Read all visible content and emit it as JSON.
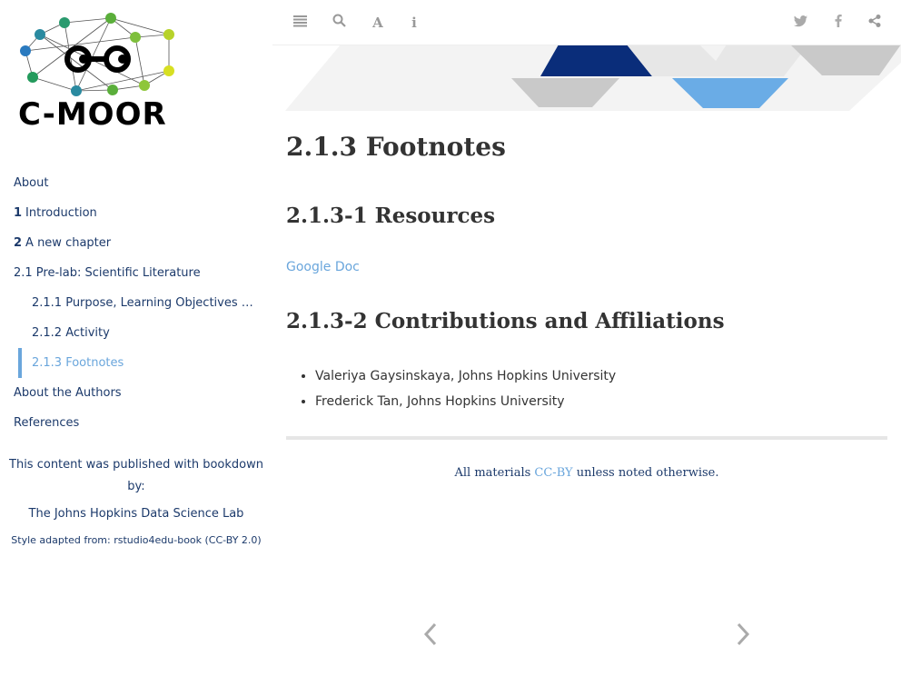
{
  "logo": {
    "text": "C-MOOR"
  },
  "toc": [
    {
      "num": "",
      "label": "About",
      "level": 0
    },
    {
      "num": "1",
      "label": "Introduction",
      "level": 0
    },
    {
      "num": "2",
      "label": "A new chapter",
      "level": 0
    },
    {
      "num": "",
      "label": "2.1 Pre-lab: Scientific Literature",
      "level": 0
    },
    {
      "num": "",
      "label": "2.1.1 Purpose, Learning Objectives and...",
      "level": 1
    },
    {
      "num": "",
      "label": "2.1.2 Activity",
      "level": 1
    },
    {
      "num": "",
      "label": "2.1.3 Footnotes",
      "level": 1,
      "active": true
    },
    {
      "num": "",
      "label": "About the Authors",
      "level": 0
    },
    {
      "num": "",
      "label": "References",
      "level": 0
    }
  ],
  "credits": {
    "line1": "This content was published with bookdown by:",
    "line2": "The Johns Hopkins Data Science Lab",
    "line3": "Style adapted from: rstudio4edu-book (CC-BY 2.0)"
  },
  "toolbar": {
    "left_icons": [
      "sidebar-toggle-icon",
      "search-icon",
      "font-settings-icon",
      "info-icon"
    ],
    "right_icons": [
      "twitter-icon",
      "facebook-icon",
      "share-icon"
    ]
  },
  "page": {
    "title": "2.1.3 Footnotes",
    "section1": "2.1.3-1 Resources",
    "link": "Google Doc",
    "section2": "2.1.3-2 Contributions and Affiliations",
    "people": [
      "Valeriya Gaysinskaya, Johns Hopkins University",
      "Frederick Tan, Johns Hopkins University"
    ],
    "license_pre": "All materials ",
    "license_link": "CC-BY",
    "license_post": " unless noted otherwise."
  },
  "colors": {
    "link": "#6aa6dc",
    "nav": "#1c3a6b",
    "banner_dark": "#0a2d7a"
  }
}
